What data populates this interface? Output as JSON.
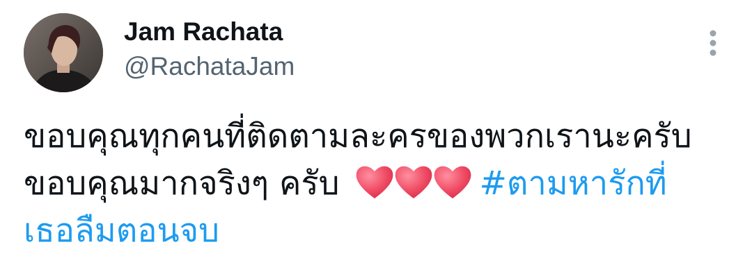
{
  "author": {
    "display_name": "Jam Rachata",
    "handle": "@RachataJam"
  },
  "tweet": {
    "line1": "ขอบคุณทุกคนที่ติดตามละครของพวกเรานะครับ",
    "line2_text": "ขอบคุณมากจริงๆ ครับ",
    "emoji": [
      "heart-emoji",
      "heart-emoji",
      "heart-emoji"
    ],
    "hashtag_part1": "#ตามหารักที่",
    "hashtag_part2": "เธอลืมตอนจบ"
  },
  "colors": {
    "text": "#0f1419",
    "secondary": "#536471",
    "link": "#1d9bf0",
    "heart": "#e8405a"
  },
  "icons": {
    "more": "more-vertical-icon"
  }
}
